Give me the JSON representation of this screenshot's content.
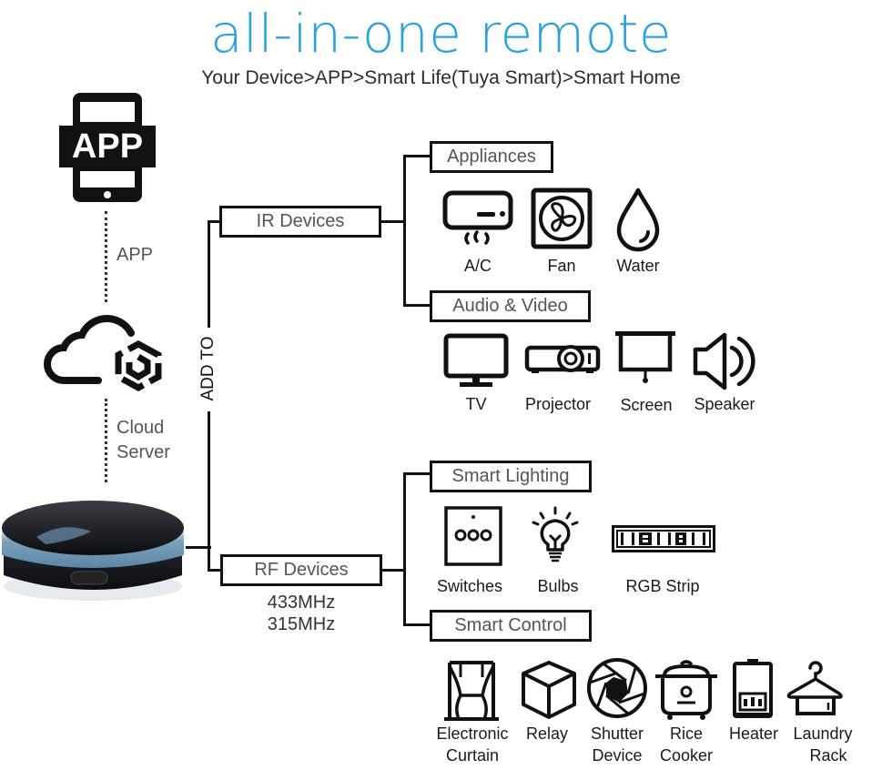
{
  "header": {
    "title": "all-in-one remote",
    "subtitle": "Your Device>APP>Smart Life(Tuya Smart)>Smart Home"
  },
  "left_column": {
    "app_icon_text": "APP",
    "app_label": "APP",
    "cloud_label_line1": "Cloud",
    "cloud_label_line2": "Server"
  },
  "connector_label": "ADD TO",
  "colors": {
    "title": "#2aa3dc",
    "lines": "#111111",
    "box_text": "#555555"
  },
  "branches": {
    "ir": {
      "label": "IR Devices",
      "groups": [
        {
          "label": "Appliances",
          "items": [
            {
              "icon": "air-conditioner-icon",
              "label": "A/C"
            },
            {
              "icon": "fan-icon",
              "label": "Fan"
            },
            {
              "icon": "water-drop-icon",
              "label": "Water"
            }
          ]
        },
        {
          "label": "Audio & Video",
          "items": [
            {
              "icon": "tv-icon",
              "label": "TV"
            },
            {
              "icon": "projector-icon",
              "label": "Projector"
            },
            {
              "icon": "projection-screen-icon",
              "label": "Screen"
            },
            {
              "icon": "speaker-icon",
              "label": "Speaker"
            }
          ]
        }
      ]
    },
    "rf": {
      "label": "RF Devices",
      "freq1": "433MHz",
      "freq2": "315MHz",
      "groups": [
        {
          "label": "Smart Lighting",
          "items": [
            {
              "icon": "wall-switch-icon",
              "label": "Switches"
            },
            {
              "icon": "light-bulb-icon",
              "label": "Bulbs"
            },
            {
              "icon": "led-strip-icon",
              "label": "RGB Strip"
            }
          ]
        },
        {
          "label": "Smart Control",
          "items": [
            {
              "icon": "curtain-icon",
              "label1": "Electronic",
              "label2": "Curtain"
            },
            {
              "icon": "relay-cube-icon",
              "label1": "Relay",
              "label2": ""
            },
            {
              "icon": "shutter-icon",
              "label1": "Shutter",
              "label2": "Device"
            },
            {
              "icon": "rice-cooker-icon",
              "label1": "Rice",
              "label2": "Cooker"
            },
            {
              "icon": "heater-icon",
              "label1": "Heater",
              "label2": ""
            },
            {
              "icon": "laundry-rack-icon",
              "label1": "Laundry",
              "label2": "Rack"
            }
          ]
        }
      ]
    }
  }
}
